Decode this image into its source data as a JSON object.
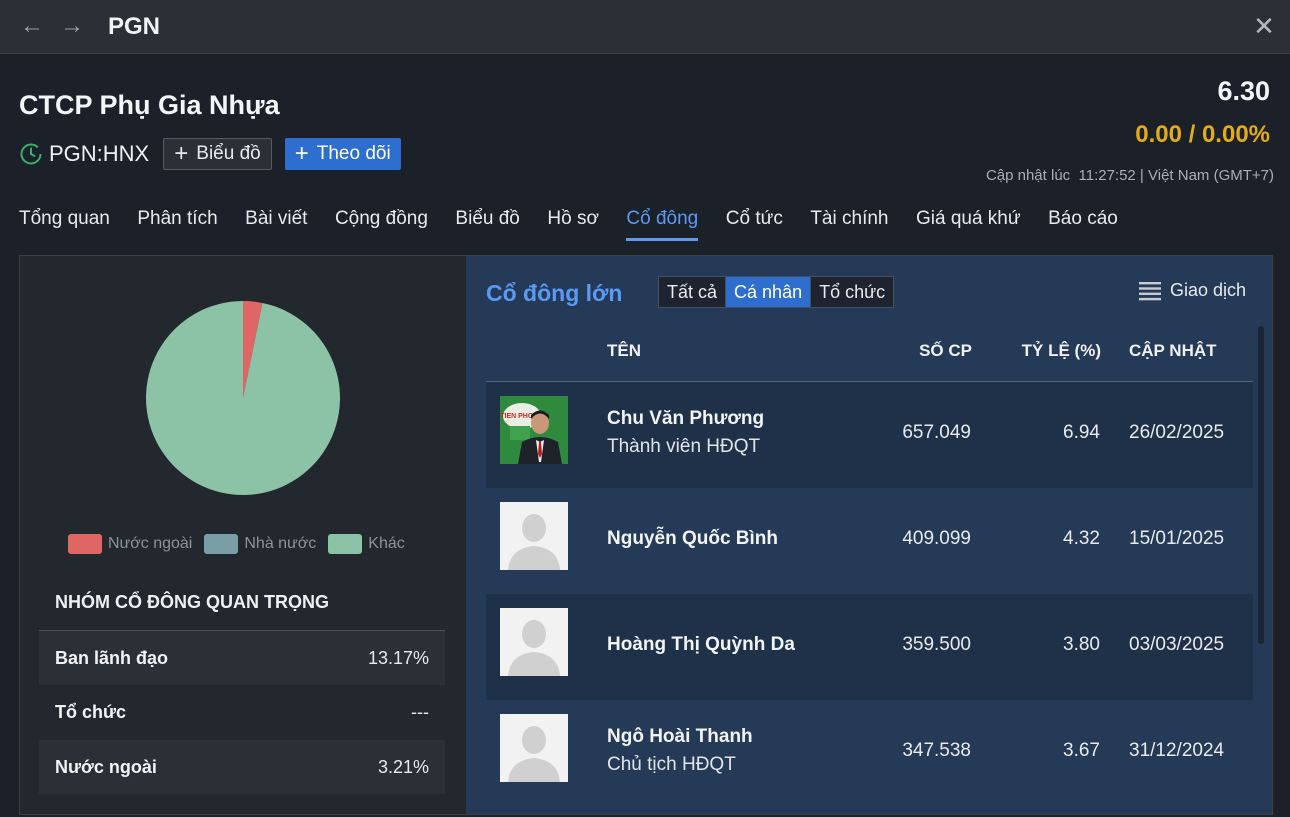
{
  "window": {
    "title": "PGN",
    "back_icon": "arrow-left-icon",
    "forward_icon": "arrow-right-icon",
    "close_icon": "close-icon"
  },
  "header": {
    "company": "CTCP Phụ Gia Nhựa",
    "ticker": "PGN:HNX",
    "chart_button": "Biểu đồ",
    "follow_button": "Theo dõi",
    "price": "6.30",
    "change": "0.00 / 0.00%",
    "update_label": "Cập nhật lúc  11:27:52 | Việt Nam (GMT+7)",
    "colors": {
      "change": "#e2ad17",
      "accent": "#2d6ecf"
    }
  },
  "tabs": [
    {
      "label": "Tổng quan"
    },
    {
      "label": "Phân tích"
    },
    {
      "label": "Bài viết"
    },
    {
      "label": "Cộng đồng"
    },
    {
      "label": "Biểu đồ"
    },
    {
      "label": "Hồ sơ"
    },
    {
      "label": "Cổ đông",
      "active": true
    },
    {
      "label": "Cổ tức"
    },
    {
      "label": "Tài chính"
    },
    {
      "label": "Giá quá khứ"
    },
    {
      "label": "Báo cáo"
    }
  ],
  "ownership": {
    "slices": [
      {
        "label": "Nước ngoài",
        "percent": 3.21,
        "color": "#e06666"
      },
      {
        "label": "Nhà nước",
        "percent": 0,
        "color": "#7a9ea5"
      },
      {
        "label": "Khác",
        "percent": 96.79,
        "color": "#8cc2a5"
      }
    ]
  },
  "groups": {
    "title": "NHÓM CỔ ĐÔNG QUAN TRỌNG",
    "rows": [
      {
        "label": "Ban lãnh đạo",
        "value": "13.17%"
      },
      {
        "label": "Tổ chức",
        "value": "---"
      },
      {
        "label": "Nước ngoài",
        "value": "3.21%"
      }
    ]
  },
  "shareholders": {
    "title": "Cổ đông lớn",
    "filters": [
      {
        "label": "Tất cả"
      },
      {
        "label": "Cá nhân",
        "active": true
      },
      {
        "label": "Tổ chức"
      }
    ],
    "trades_label": "Giao dịch",
    "columns": {
      "name": "TÊN",
      "shares": "SỐ CP",
      "ratio": "TỶ LỆ (%)",
      "date": "CẬP NHẬT"
    },
    "rows": [
      {
        "name": "Chu Văn Phương",
        "role": "Thành viên HĐQT",
        "shares": "657.049",
        "ratio": "6.94",
        "date": "26/02/2025",
        "avatar": "photo"
      },
      {
        "name": "Nguyễn Quốc Bình",
        "role": "",
        "shares": "409.099",
        "ratio": "4.32",
        "date": "15/01/2025",
        "avatar": "placeholder"
      },
      {
        "name": "Hoàng Thị Quỳnh Da",
        "role": "",
        "shares": "359.500",
        "ratio": "3.80",
        "date": "03/03/2025",
        "avatar": "placeholder"
      },
      {
        "name": "Ngô Hoài Thanh",
        "role": "Chủ tịch HĐQT",
        "shares": "347.538",
        "ratio": "3.67",
        "date": "31/12/2024",
        "avatar": "placeholder"
      }
    ]
  }
}
